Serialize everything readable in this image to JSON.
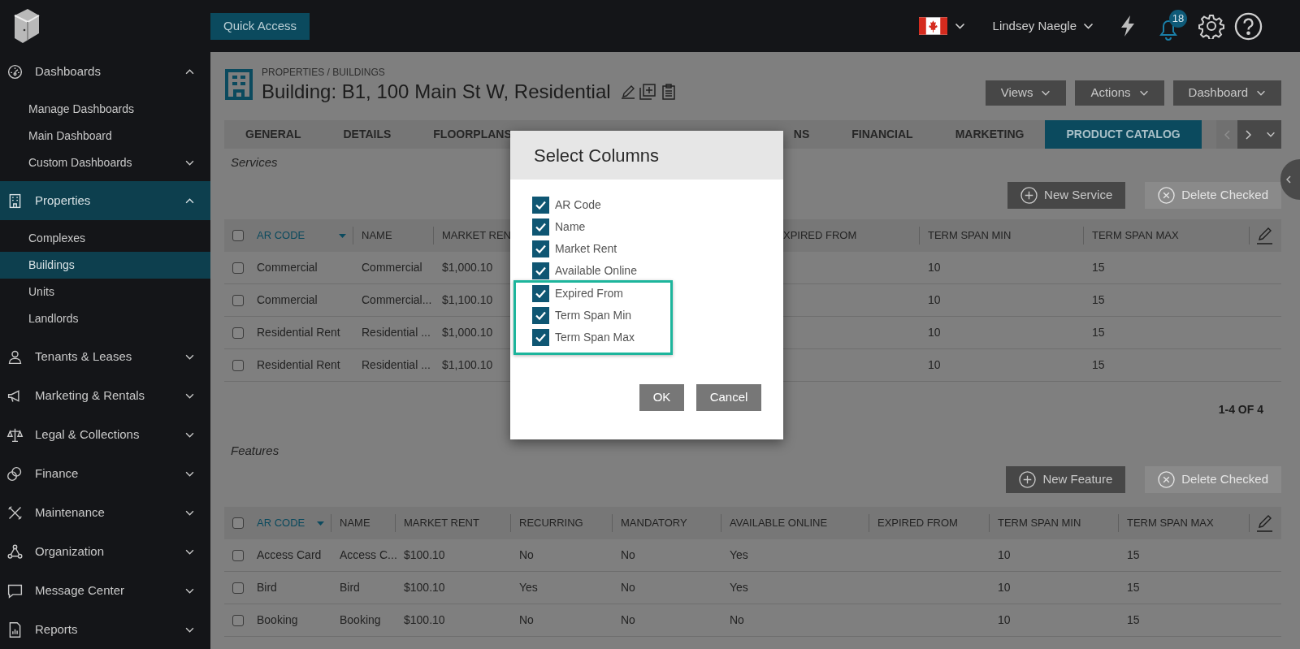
{
  "top_bar": {
    "quick_access": "Quick Access",
    "user": "Lindsey Naegle",
    "notification_count": "18"
  },
  "sidebar": {
    "items": [
      {
        "label": "Dashboards",
        "expanded": true,
        "selected": false,
        "children": [
          {
            "label": "Manage Dashboards",
            "selected": false
          },
          {
            "label": "Main Dashboard",
            "selected": false
          },
          {
            "label": "Custom Dashboards",
            "selected": false,
            "expanded": false
          }
        ]
      },
      {
        "label": "Properties",
        "expanded": true,
        "selected": true,
        "children": [
          {
            "label": "Complexes",
            "selected": false
          },
          {
            "label": "Buildings",
            "selected": true
          },
          {
            "label": "Units",
            "selected": false
          },
          {
            "label": "Landlords",
            "selected": false
          }
        ]
      },
      {
        "label": "Tenants & Leases",
        "expanded": false,
        "selected": false
      },
      {
        "label": "Marketing & Rentals",
        "expanded": false,
        "selected": false
      },
      {
        "label": "Legal & Collections",
        "expanded": false,
        "selected": false
      },
      {
        "label": "Finance",
        "expanded": false,
        "selected": false
      },
      {
        "label": "Maintenance",
        "expanded": false,
        "selected": false
      },
      {
        "label": "Organization",
        "expanded": false,
        "selected": false
      },
      {
        "label": "Message Center",
        "expanded": false,
        "selected": false
      },
      {
        "label": "Reports",
        "expanded": false,
        "selected": false
      }
    ]
  },
  "header": {
    "breadcrumb": "PROPERTIES / BUILDINGS",
    "title": "Building: B1, 100 Main St W, Residential",
    "menus": [
      "Views",
      "Actions",
      "Dashboard"
    ]
  },
  "tabs": [
    {
      "label": "GENERAL",
      "selected": false
    },
    {
      "label": "DETAILS",
      "selected": false
    },
    {
      "label": "FLOORPLANS",
      "selected": false
    },
    {
      "label": "NS",
      "selected": false
    },
    {
      "label": "FINANCIAL",
      "selected": false
    },
    {
      "label": "MARKETING",
      "selected": false
    },
    {
      "label": "PRODUCT CATALOG",
      "selected": true
    }
  ],
  "services": {
    "title": "Services",
    "buttons": [
      {
        "label": "New Service",
        "kind": "add",
        "disabled": false
      },
      {
        "label": "Delete Checked",
        "kind": "delete",
        "disabled": true
      }
    ],
    "all_checked": false,
    "columns": [
      {
        "label": "AR CODE",
        "sorted": true
      },
      {
        "label": "NAME",
        "sorted": false
      },
      {
        "label": "MARKET REN",
        "sorted": false
      },
      {
        "label": "XPIRED FROM",
        "sorted": false
      },
      {
        "label": "TERM SPAN MIN",
        "sorted": false
      },
      {
        "label": "TERM SPAN MAX",
        "sorted": false
      }
    ],
    "rows": [
      {
        "checked": false,
        "ar_code": "Commercial",
        "name": "Commercial",
        "market_rent": "$1,000.10",
        "term_span_min": "10",
        "term_span_max": "15"
      },
      {
        "checked": false,
        "ar_code": "Commercial",
        "name": "Commercial...",
        "market_rent": "$1,100.10",
        "term_span_min": "10",
        "term_span_max": "15"
      },
      {
        "checked": false,
        "ar_code": "Residential Rent",
        "name": "Residential ...",
        "market_rent": "$1,000.10",
        "term_span_min": "10",
        "term_span_max": "15"
      },
      {
        "checked": false,
        "ar_code": "Residential Rent",
        "name": "Residential ...",
        "market_rent": "$1,100.10",
        "term_span_min": "10",
        "term_span_max": "15"
      }
    ],
    "pagination": "1-4 OF 4"
  },
  "features": {
    "title": "Features",
    "buttons": [
      {
        "label": "New Feature",
        "kind": "add",
        "disabled": false
      },
      {
        "label": "Delete Checked",
        "kind": "delete",
        "disabled": true
      }
    ],
    "all_checked": false,
    "columns": [
      {
        "label": "AR CODE",
        "sorted": true
      },
      {
        "label": "NAME",
        "sorted": false
      },
      {
        "label": "MARKET RENT",
        "sorted": false
      },
      {
        "label": "RECURRING",
        "sorted": false
      },
      {
        "label": "MANDATORY",
        "sorted": false
      },
      {
        "label": "AVAILABLE ONLINE",
        "sorted": false
      },
      {
        "label": "EXPIRED FROM",
        "sorted": false
      },
      {
        "label": "TERM SPAN MIN",
        "sorted": false
      },
      {
        "label": "TERM SPAN MAX",
        "sorted": false
      }
    ],
    "rows": [
      {
        "checked": false,
        "ar_code": "Access Card",
        "name": "Access C...",
        "market_rent": "$100.10",
        "recurring": "No",
        "mandatory": "No",
        "available_online": "Yes",
        "term_span_min": "10",
        "term_span_max": "15"
      },
      {
        "checked": false,
        "ar_code": "Bird",
        "name": "Bird",
        "market_rent": "$100.10",
        "recurring": "Yes",
        "mandatory": "No",
        "available_online": "Yes",
        "term_span_min": "10",
        "term_span_max": "15"
      },
      {
        "checked": false,
        "ar_code": "Booking",
        "name": "Booking",
        "market_rent": "$100.10",
        "recurring": "No",
        "mandatory": "No",
        "available_online": "No",
        "term_span_min": "10",
        "term_span_max": "15"
      }
    ]
  },
  "dialog": {
    "title": "Select Columns",
    "options": [
      {
        "label": "AR Code",
        "checked": true,
        "highlighted": false
      },
      {
        "label": "Name",
        "checked": true,
        "highlighted": false
      },
      {
        "label": "Market Rent",
        "checked": true,
        "highlighted": false
      },
      {
        "label": "Available Online",
        "checked": true,
        "highlighted": false
      },
      {
        "label": "Expired From",
        "checked": true,
        "highlighted": true
      },
      {
        "label": "Term Span Min",
        "checked": true,
        "highlighted": true
      },
      {
        "label": "Term Span Max",
        "checked": true,
        "highlighted": true
      }
    ],
    "buttons": [
      "OK",
      "Cancel"
    ]
  }
}
